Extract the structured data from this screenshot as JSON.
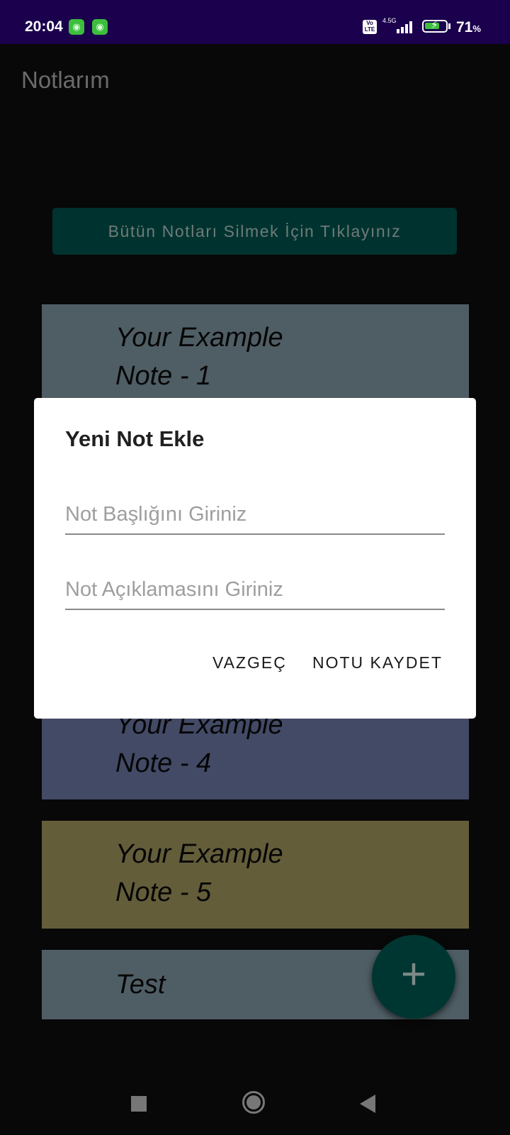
{
  "status_bar": {
    "time": "20:04",
    "app_icon": "cat-icon",
    "volte": "Vo LTE",
    "network": "4.5G",
    "battery_percent": "71",
    "percent_sign": "%"
  },
  "app": {
    "title": "Notlarım"
  },
  "delete_all_button": "Bütün Notları Silmek İçin Tıklayınız",
  "notes": [
    {
      "title": "Your Example Note - 1",
      "color": "#4f5d64"
    },
    {
      "title": "Your Example Note - 4",
      "color": "#434a66"
    },
    {
      "title": "Your Example Note - 5",
      "color": "#645d3a"
    },
    {
      "title": "Test",
      "color": "#4f5e65"
    }
  ],
  "fab": {
    "icon": "plus-icon",
    "label": "+"
  },
  "dialog": {
    "title": "Yeni Not Ekle",
    "title_placeholder": "Not Başlığını Giriniz",
    "description_placeholder": "Not Açıklamasını Giriniz",
    "cancel": "VAZGEÇ",
    "save": "NOTU KAYDET"
  }
}
